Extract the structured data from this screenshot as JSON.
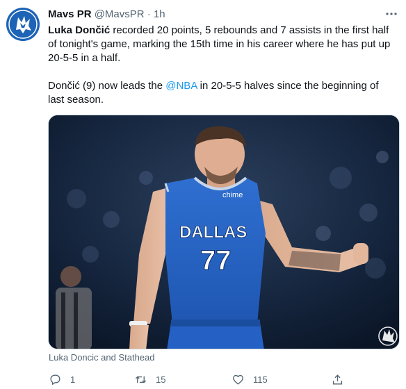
{
  "tweet": {
    "display_name": "Mavs PR",
    "handle": "@MavsPR",
    "separator": "·",
    "time": "1h",
    "paragraph1": {
      "bold_name": "Luka Dončić",
      "rest": " recorded 20 points, 5 rebounds and 7 assists in the first half of tonight's game, marking the 15th time in his career where he has put up 20-5-5 in a half."
    },
    "paragraph2": {
      "before_mention": "Dončić (9) now leads the ",
      "mention": "@NBA",
      "after_mention": " in 20-5-5 halves since the beginning of last season."
    },
    "media": {
      "jersey_team": "DALLAS",
      "jersey_number": "77",
      "jersey_sponsor": "chime"
    },
    "caption": "Luka Doncic and Stathead",
    "actions": {
      "reply_count": "1",
      "retweet_count": "15",
      "like_count": "115"
    }
  },
  "colors": {
    "accent": "#1d9bf0",
    "secondary_text": "#536471",
    "mavs_blue": "#1d64b6"
  },
  "icons": [
    "mavs-logo-icon",
    "more-icon",
    "reply-icon",
    "retweet-icon",
    "like-icon",
    "share-icon"
  ]
}
